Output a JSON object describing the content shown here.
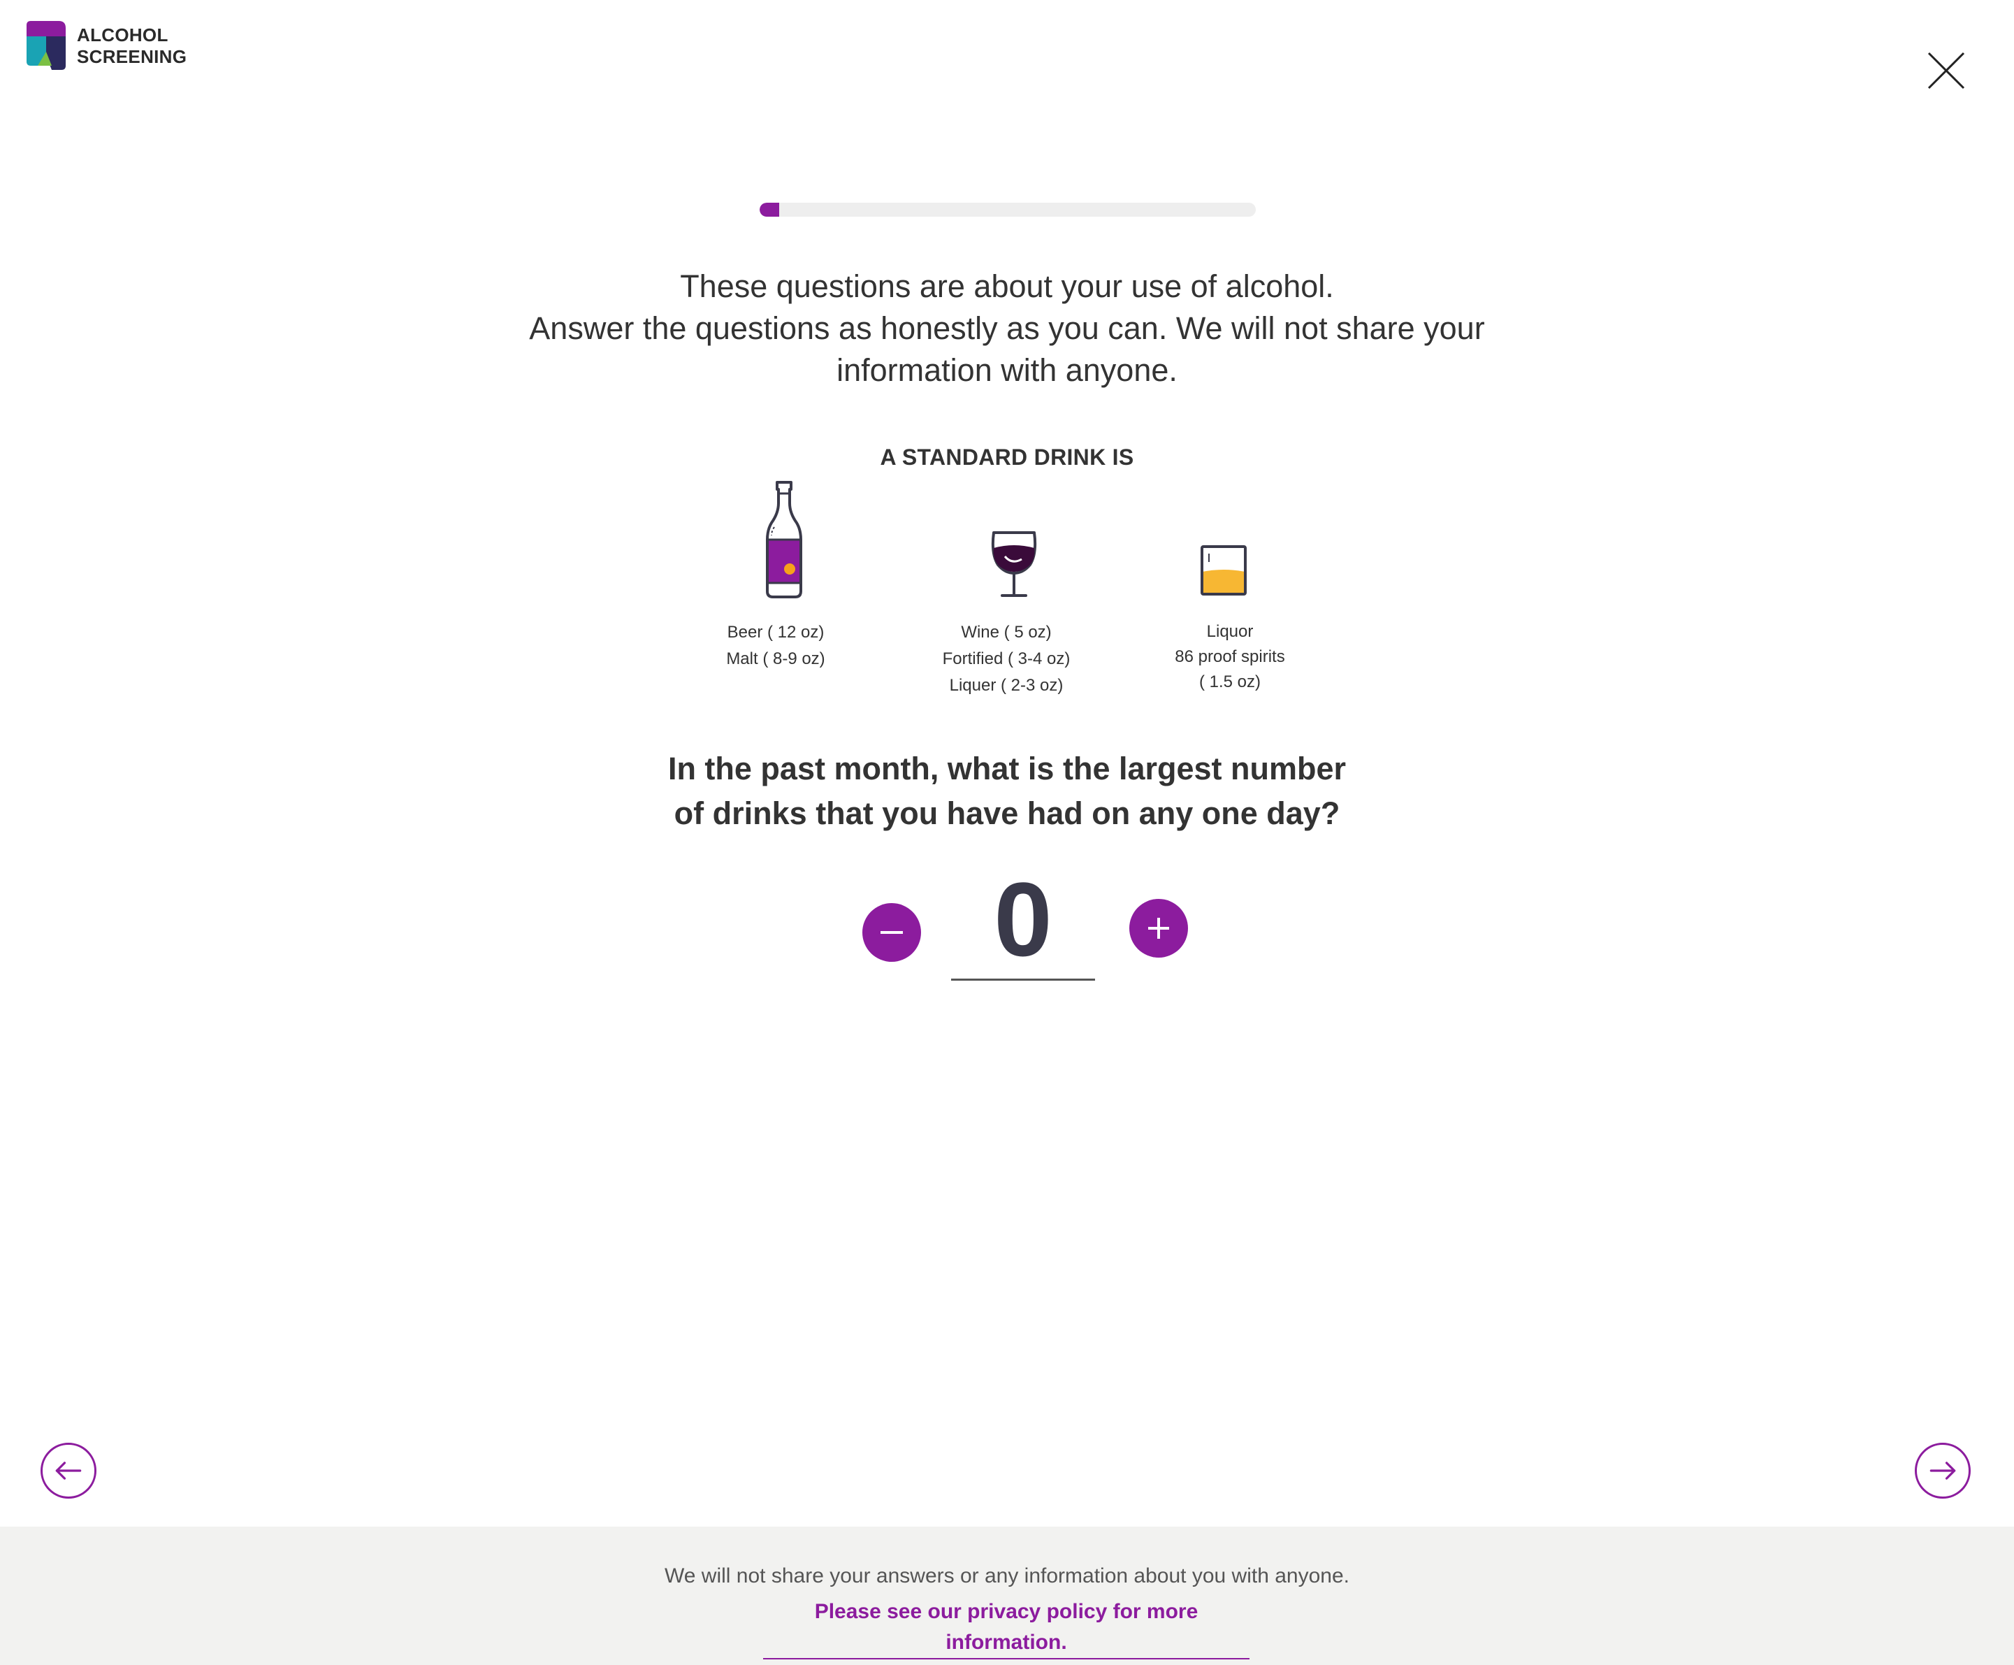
{
  "header": {
    "logo_line1": "ALCOHOL",
    "logo_line2": "SCREENING"
  },
  "progress": {
    "fraction": 0.04
  },
  "intro": {
    "line1": "These questions are about your use of alcohol.",
    "line2": "Answer the questions as honestly as you can. We will not share your",
    "line3": "information with anyone."
  },
  "standard_drink": {
    "title": "A STANDARD DRINK IS",
    "beer": {
      "line1": "Beer ( 12 oz)",
      "line2": "Malt ( 8-9 oz)"
    },
    "wine": {
      "line1": "Wine ( 5 oz)",
      "line2": "Fortified ( 3-4 oz)",
      "line3": "Liquer ( 2-3 oz)"
    },
    "liquor": {
      "line1": "Liquor",
      "line2": "86 proof spirits",
      "line3": "( 1.5 oz)"
    }
  },
  "question": {
    "line1": "In the past month, what is the largest number",
    "line2": "of drinks that you have had on any one day?"
  },
  "stepper": {
    "value": "0"
  },
  "footer": {
    "text": "We will not share your answers or any information about you with anyone.",
    "link": "Please see our privacy policy for more information."
  },
  "colors": {
    "accent": "#8c1c9e",
    "footer_bg": "#f2f2f0",
    "beer_label": "#8c1c9e",
    "liquor_fill": "#f7b733",
    "wine_fill": "#3a0b3a"
  },
  "icons": [
    "logo-icon",
    "close-icon",
    "beer-bottle-icon",
    "wine-glass-icon",
    "liquor-glass-icon",
    "minus-icon",
    "plus-icon",
    "arrow-left-icon",
    "arrow-right-icon"
  ]
}
